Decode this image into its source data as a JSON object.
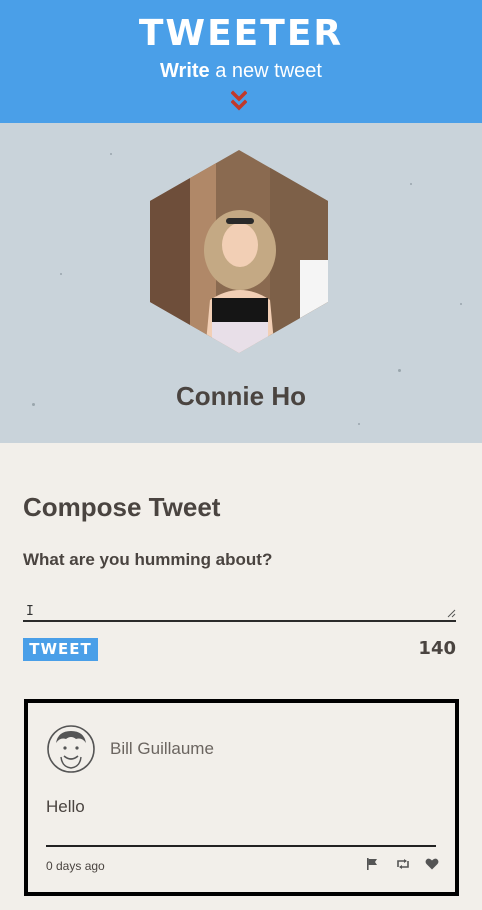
{
  "nav": {
    "brand": "TWEETER",
    "compose_bold": "Write",
    "compose_rest": " a new tweet"
  },
  "profile": {
    "name": "Connie Ho"
  },
  "compose": {
    "title": "Compose Tweet",
    "label": "What are you humming about?",
    "value": "",
    "button_label": "TWEET",
    "counter": "140"
  },
  "tweets": [
    {
      "author": "Bill Guillaume",
      "text": "Hello",
      "timestamp": "0 days ago",
      "actions": [
        "flag-icon",
        "retweet-icon",
        "heart-icon"
      ]
    }
  ],
  "colors": {
    "nav_bg": "#4a9fe8",
    "chevron": "#c0392b",
    "page_bg": "#f2efea",
    "profile_bg": "#c9d3da"
  }
}
